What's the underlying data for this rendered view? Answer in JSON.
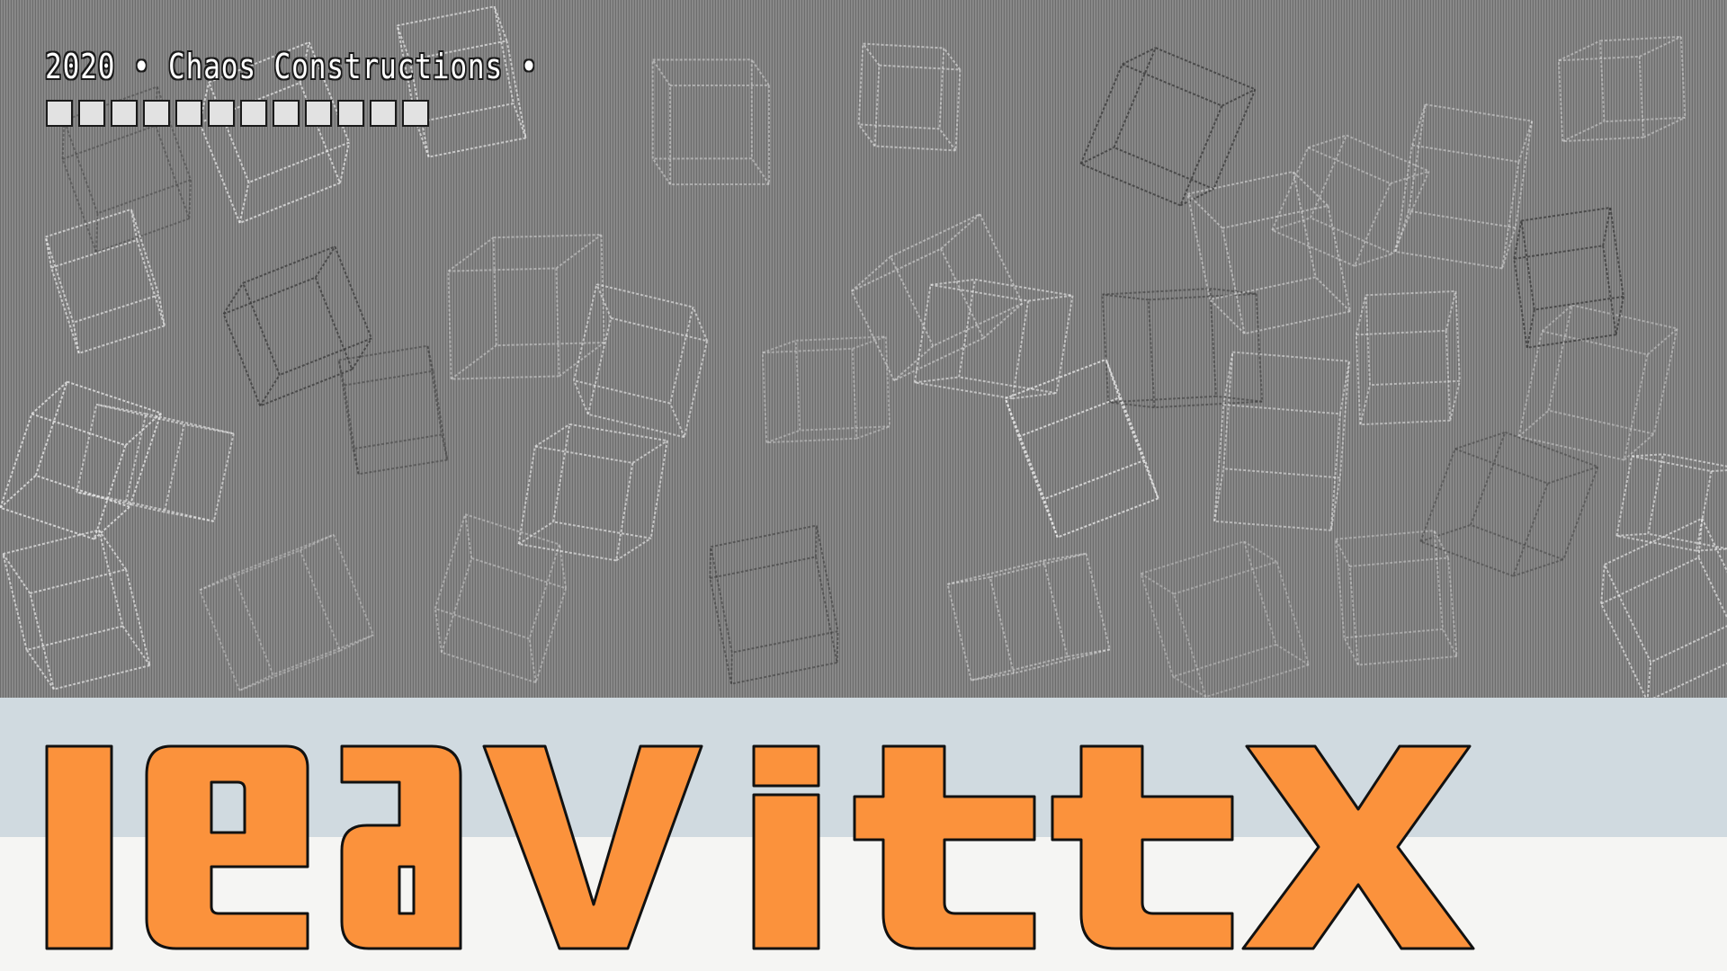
{
  "header": {
    "title": "2020 • Chaos Constructions •",
    "loading_blocks": 12
  },
  "logo": {
    "text": "leavittx",
    "fill_color": "#fb923c",
    "outline_color": "#111111"
  },
  "colors": {
    "canvas_gray": "#858585",
    "band_blue": "#d0dae0",
    "band_offwhite": "#f5f5f3",
    "cube_line_light": "#e8e8e8",
    "cube_line_dark": "#3a3a3a"
  },
  "icons": {
    "cubes": "wireframe-cube-icon",
    "blocks": "loading-block-icon"
  }
}
